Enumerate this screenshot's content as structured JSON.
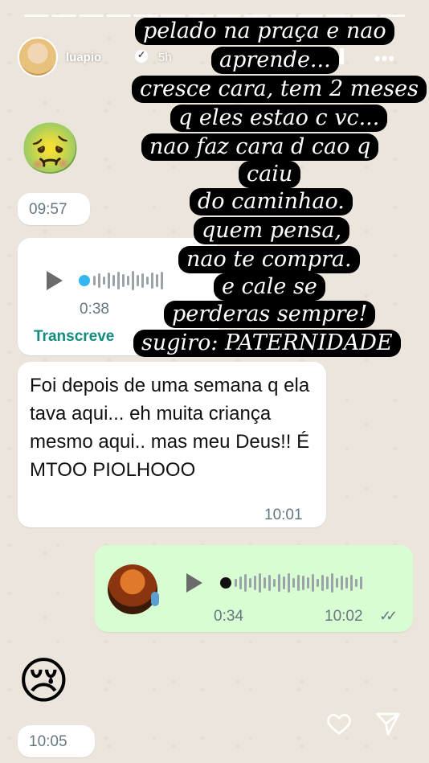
{
  "story": {
    "username": "luapio",
    "time_ago": "5h",
    "progress_segments": 14
  },
  "overlay_lines": [
    "pelado na praça e nao",
    "aprende...",
    "cresce cara, tem 2 meses",
    "q eles estao c vc...",
    "nao faz cara d cao q",
    "caiu",
    "do caminhao.",
    "quem pensa,",
    "nao te compra.",
    "e cale se",
    "perderas sempre!",
    "sugiro: PATERNIDADE"
  ],
  "chat": {
    "msg1_time": "09:57",
    "voice1_duration": "0:38",
    "voice1_transcribe": "Transcreve",
    "text_message": "Foi depois de uma semana q ela tava aqui... eh muita criança mesmo aqui.. mas meu Deus!! É MTOO PIOLHOOO",
    "text_time": "10:01",
    "voice2_duration": "0:34",
    "voice2_time": "10:02",
    "last_time": "10:05"
  },
  "colors": {
    "bubble_out": "#d9fdd3",
    "bubble_in": "#ffffff",
    "accent_blue": "#34b7f1",
    "accent_green": "#128c7e"
  }
}
